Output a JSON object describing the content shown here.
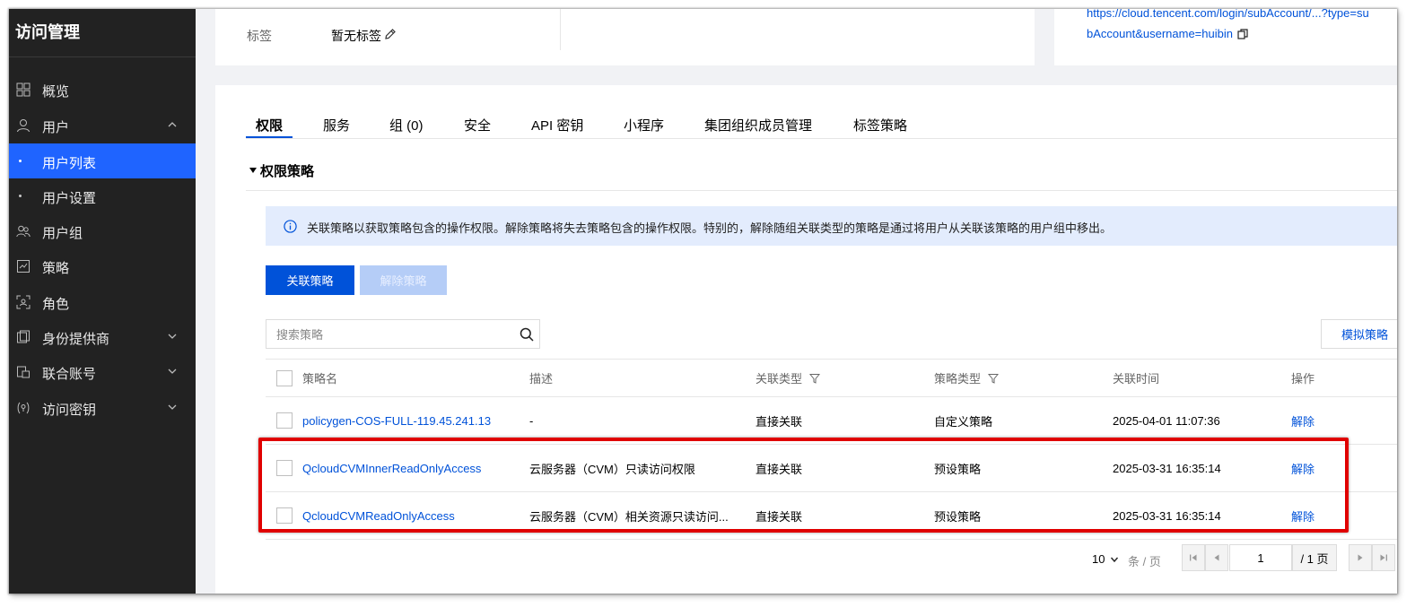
{
  "sidebar": {
    "title": "访问管理",
    "items": [
      {
        "label": "概览"
      },
      {
        "label": "用户"
      },
      {
        "label": "用户列表"
      },
      {
        "label": "用户设置"
      },
      {
        "label": "用户组"
      },
      {
        "label": "策略"
      },
      {
        "label": "角色"
      },
      {
        "label": "身份提供商"
      },
      {
        "label": "联合账号"
      },
      {
        "label": "访问密钥"
      }
    ],
    "active_color": "#1f64ff"
  },
  "top_info": {
    "tag_label": "标签",
    "tag_value": "暂无标签",
    "url_line1": "https://cloud.tencent.com/login/subAccount/...?type=su",
    "url_line2": "bAccount&username=huibin"
  },
  "tabs": [
    {
      "label": "权限"
    },
    {
      "label": "服务"
    },
    {
      "label": "组 (0)"
    },
    {
      "label": "安全"
    },
    {
      "label": "API 密钥"
    },
    {
      "label": "小程序"
    },
    {
      "label": "集团组织成员管理"
    },
    {
      "label": "标签策略"
    }
  ],
  "section": {
    "title": "权限策略"
  },
  "notice": {
    "text": "关联策略以获取策略包含的操作权限。解除策略将失去策略包含的操作权限。特别的，解除随组关联类型的策略是通过将用户从关联该策略的用户组中移出。"
  },
  "actions": {
    "attach_label": "关联策略",
    "detach_label": "解除策略",
    "simulate_label": "模拟策略"
  },
  "search": {
    "placeholder": "搜索策略"
  },
  "table": {
    "columns": [
      "策略名",
      "描述",
      "关联类型",
      "策略类型",
      "关联时间",
      "操作"
    ],
    "rows": [
      {
        "name": "policygen-COS-FULL-119.45.241.13",
        "desc": "-",
        "assoc_type": "直接关联",
        "policy_type": "自定义策略",
        "time": "2025-04-01 11:07:36",
        "op": "解除"
      },
      {
        "name": "QcloudCVMInnerReadOnlyAccess",
        "desc": "云服务器（CVM）只读访问权限",
        "assoc_type": "直接关联",
        "policy_type": "预设策略",
        "time": "2025-03-31 16:35:14",
        "op": "解除"
      },
      {
        "name": "QcloudCVMReadOnlyAccess",
        "desc": "云服务器（CVM）相关资源只读访问...",
        "assoc_type": "直接关联",
        "policy_type": "预设策略",
        "time": "2025-03-31 16:35:14",
        "op": "解除"
      }
    ]
  },
  "pagination": {
    "page_size": "10",
    "per_page_label": "条 / 页",
    "current_page": "1",
    "total_pages": "/ 1 页"
  },
  "colors": {
    "primary": "#0052d9",
    "highlight_border": "#e00000"
  }
}
